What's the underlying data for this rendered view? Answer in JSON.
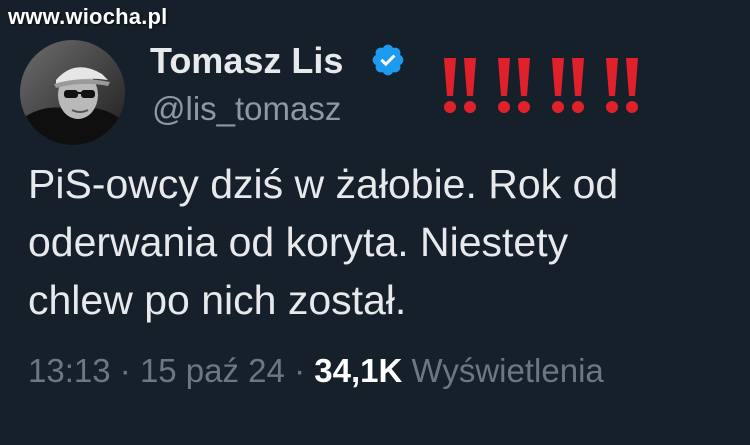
{
  "watermark": "www.wiocha.pl",
  "tweet": {
    "display_name": "Tomasz Lis",
    "handle": "@lis_tomasz",
    "verified_icon": "verified-badge-icon",
    "text": "PiS-owcy dziś w żałobie. Rok od\noderwania od koryta. Niestety\nchlew po nich został.",
    "time": "13:13",
    "separator": "·",
    "date": "15 paź 24",
    "views_count": "34,1K",
    "views_label": "Wyświetlenia"
  },
  "overlay": {
    "icon": "double-exclamation-icon",
    "count": 4,
    "color": "#e0202a"
  },
  "colors": {
    "background": "#15202b",
    "text": "#e7e9ea",
    "secondary": "#8b98a5",
    "verified": "#1d9bf0"
  }
}
